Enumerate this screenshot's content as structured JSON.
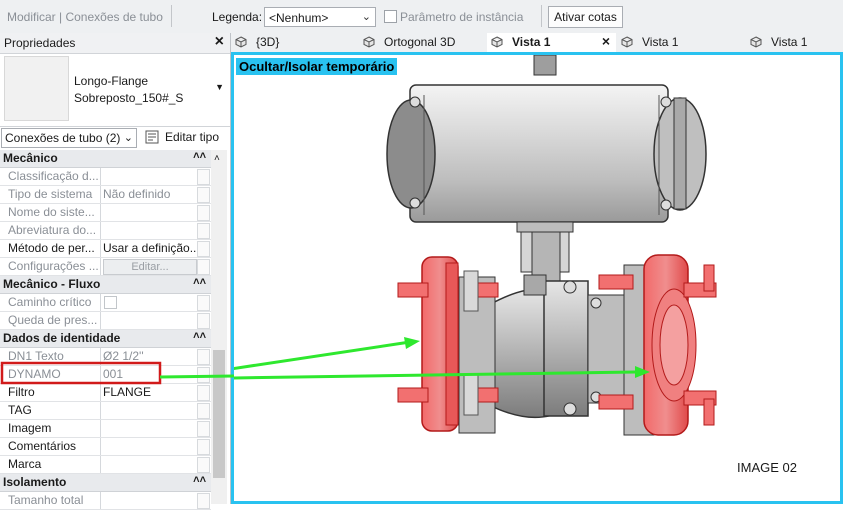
{
  "toolbar": {
    "context": "Modificar | Conexões de tubo",
    "legend_label": "Legenda:",
    "legend_value": "<Nenhum>",
    "instance_param_label": "Parâmetro de instância",
    "activate_dims_label": "Ativar cotas"
  },
  "properties": {
    "title": "Propriedades",
    "close": "×",
    "type_name_line1": "Longo-Flange",
    "type_name_line2": "Sobreposto_150#_S",
    "filter_value": "Conexões de tubo (2)",
    "edit_type_label": "Editar tipo",
    "groups": [
      {
        "name": "Mecânico",
        "rows": [
          {
            "key": "Classificação d...",
            "value": ""
          },
          {
            "key": "Tipo de sistema",
            "value": "Não definido"
          },
          {
            "key": "Nome do siste...",
            "value": ""
          },
          {
            "key": "Abreviatura do...",
            "value": ""
          },
          {
            "key": "Método de per...",
            "value": "Usar a definição..."
          },
          {
            "key": "Configurações ...",
            "value": "Editar..."
          }
        ]
      },
      {
        "name": "Mecânico - Fluxo",
        "rows": [
          {
            "key": "Caminho crítico",
            "value": ""
          },
          {
            "key": "Queda de pres...",
            "value": ""
          }
        ]
      },
      {
        "name": "Dados de identidade",
        "rows": [
          {
            "key": "DN1 Texto",
            "value": "Ø2 1/2''"
          },
          {
            "key": "DYNAMO",
            "value": "001"
          },
          {
            "key": "Filtro",
            "value": "FLANGE"
          },
          {
            "key": "TAG",
            "value": ""
          },
          {
            "key": "Imagem",
            "value": ""
          },
          {
            "key": "Comentários",
            "value": ""
          },
          {
            "key": "Marca",
            "value": ""
          }
        ]
      },
      {
        "name": "Isolamento",
        "rows": [
          {
            "key": "Tamanho total",
            "value": ""
          }
        ]
      }
    ]
  },
  "tabs": [
    {
      "label": "{3D}",
      "active": false
    },
    {
      "label": "Ortogonal 3D",
      "active": false
    },
    {
      "label": "Vista 1",
      "active": true
    },
    {
      "label": "Vista 1",
      "active": false
    },
    {
      "label": "Vista 1",
      "active": false
    }
  ],
  "viewport": {
    "temporary_label": "Ocultar/Isolar temporário",
    "caption": "IMAGE 02"
  },
  "colors": {
    "highlight_border": "#29c2f0",
    "annotation_green": "#2ee82e",
    "annotation_red": "#d11a1a",
    "flange_red": "#f04848"
  }
}
